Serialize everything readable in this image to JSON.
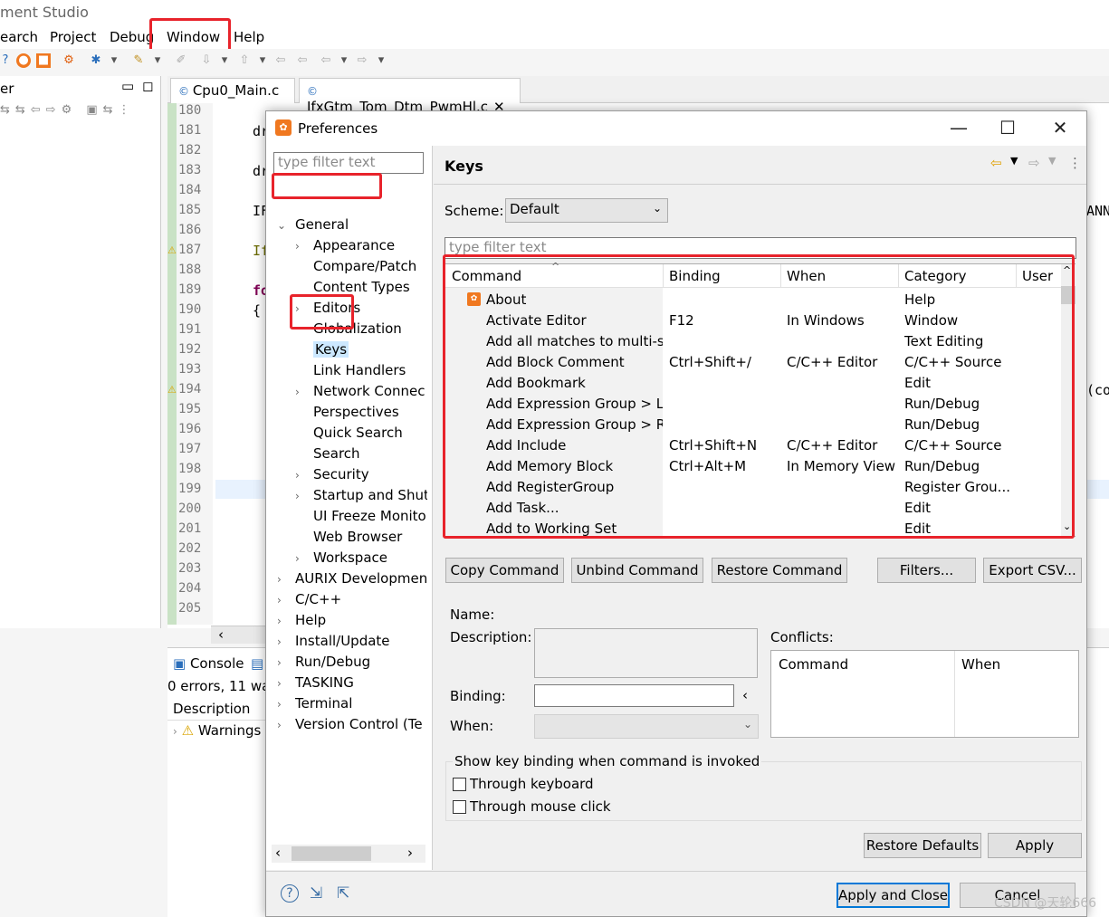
{
  "ide": {
    "title": "ment Studio",
    "menu": [
      "earch",
      "Project",
      "Debug",
      "Window",
      "Help"
    ],
    "view_title": "er",
    "editor_tabs": [
      "Cpu0_Main.c",
      "IfxGtm_Tom_Dtm_PwmHl.c"
    ],
    "line_numbers": [
      "180",
      "181",
      "182",
      "183",
      "184",
      "185",
      "186",
      "187",
      "188",
      "189",
      "190",
      "191",
      "192",
      "193",
      "194",
      "195",
      "196",
      "197",
      "198",
      "199",
      "200",
      "201",
      "202",
      "203",
      "204",
      "205"
    ],
    "code_fragments": {
      "l181": "dr",
      "l183": "dr",
      "l185": "IF",
      "l187": "If",
      "l189": "fo",
      "l190": "{",
      "r185": "ANN",
      "r194": "(co"
    },
    "console_tab": "Console",
    "console_status": "0 errors, 11 wa",
    "description_header": "Description",
    "warnings_row": "Warnings"
  },
  "dialog": {
    "title": "Preferences",
    "filter_placeholder": "type filter text",
    "tree": [
      {
        "label": "General",
        "expanded": true,
        "level": 0
      },
      {
        "label": "Appearance",
        "expandable": true,
        "level": 1
      },
      {
        "label": "Compare/Patch",
        "level": 1
      },
      {
        "label": "Content Types",
        "level": 1
      },
      {
        "label": "Editors",
        "expandable": true,
        "level": 1
      },
      {
        "label": "Globalization",
        "level": 1
      },
      {
        "label": "Keys",
        "level": 1,
        "selected": true
      },
      {
        "label": "Link Handlers",
        "level": 1
      },
      {
        "label": "Network Connec",
        "expandable": true,
        "level": 1
      },
      {
        "label": "Perspectives",
        "level": 1
      },
      {
        "label": "Quick Search",
        "level": 1
      },
      {
        "label": "Search",
        "level": 1
      },
      {
        "label": "Security",
        "expandable": true,
        "level": 1
      },
      {
        "label": "Startup and Shut",
        "expandable": true,
        "level": 1
      },
      {
        "label": "UI Freeze Monito",
        "level": 1
      },
      {
        "label": "Web Browser",
        "level": 1
      },
      {
        "label": "Workspace",
        "expandable": true,
        "level": 1
      },
      {
        "label": "AURIX Developmen",
        "expandable": true,
        "level": 0
      },
      {
        "label": "C/C++",
        "expandable": true,
        "level": 0
      },
      {
        "label": "Help",
        "expandable": true,
        "level": 0
      },
      {
        "label": "Install/Update",
        "expandable": true,
        "level": 0
      },
      {
        "label": "Run/Debug",
        "expandable": true,
        "level": 0
      },
      {
        "label": "TASKING",
        "expandable": true,
        "level": 0
      },
      {
        "label": "Terminal",
        "expandable": true,
        "level": 0
      },
      {
        "label": "Version Control (Te",
        "expandable": true,
        "level": 0
      }
    ],
    "page_title": "Keys",
    "scheme_label": "Scheme:",
    "scheme_value": "Default",
    "keys_filter_placeholder": "type filter text",
    "columns": [
      "Command",
      "Binding",
      "When",
      "Category",
      "User"
    ],
    "rows": [
      {
        "command": "About",
        "binding": "",
        "when": "",
        "category": "Help",
        "icon": true
      },
      {
        "command": "Activate Editor",
        "binding": "F12",
        "when": "In Windows",
        "category": "Window"
      },
      {
        "command": "Add all matches to multi-se",
        "binding": "",
        "when": "",
        "category": "Text Editing"
      },
      {
        "command": "Add Block Comment",
        "binding": "Ctrl+Shift+/",
        "when": "C/C++ Editor",
        "category": "C/C++ Source"
      },
      {
        "command": "Add Bookmark",
        "binding": "",
        "when": "",
        "category": "Edit"
      },
      {
        "command": "Add Expression Group > Lo",
        "binding": "",
        "when": "",
        "category": "Run/Debug"
      },
      {
        "command": "Add Expression Group > Re",
        "binding": "",
        "when": "",
        "category": "Run/Debug"
      },
      {
        "command": "Add Include",
        "binding": "Ctrl+Shift+N",
        "when": "C/C++ Editor",
        "category": "C/C++ Source"
      },
      {
        "command": "Add Memory Block",
        "binding": "Ctrl+Alt+M",
        "when": "In Memory View",
        "category": "Run/Debug"
      },
      {
        "command": "Add RegisterGroup",
        "binding": "",
        "when": "",
        "category": "Register Grou..."
      },
      {
        "command": "Add Task...",
        "binding": "",
        "when": "",
        "category": "Edit"
      },
      {
        "command": "Add to Working Set",
        "binding": "",
        "when": "",
        "category": "Edit"
      }
    ],
    "buttons": {
      "copy": "Copy Command",
      "unbind": "Unbind Command",
      "restore_cmd": "Restore Command",
      "filters": "Filters...",
      "export": "Export CSV...",
      "restore_defaults": "Restore Defaults",
      "apply": "Apply",
      "apply_close": "Apply and Close",
      "cancel": "Cancel"
    },
    "name_label": "Name:",
    "description_label": "Description:",
    "binding_label": "Binding:",
    "when_label": "When:",
    "conflicts_label": "Conflicts:",
    "conflicts_columns": [
      "Command",
      "When"
    ],
    "show_binding_label": "Show key binding when command is invoked",
    "through_keyboard": "Through keyboard",
    "through_mouse": "Through mouse click",
    "watermark": "CSDN @天轮666"
  },
  "colors": {
    "highlight": "#e8232b",
    "selection": "#cce8ff",
    "accent": "#0078d7"
  }
}
